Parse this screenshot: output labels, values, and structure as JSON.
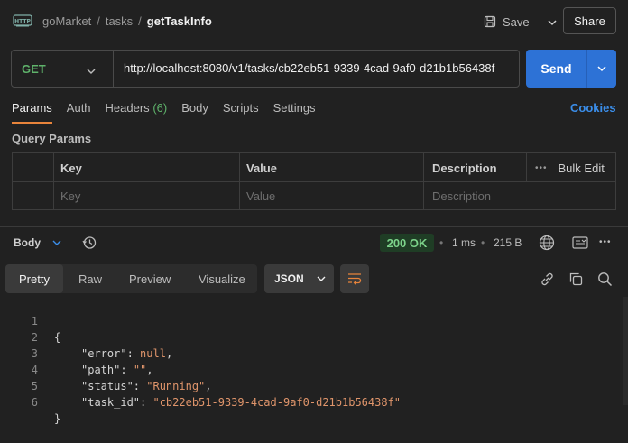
{
  "header": {
    "breadcrumb": [
      "goMarket",
      "tasks",
      "getTaskInfo"
    ],
    "save_label": "Save",
    "share_label": "Share",
    "icon_text": "HTTP"
  },
  "request": {
    "method": "GET",
    "url": "http://localhost:8080/v1/tasks/cb22eb51-9339-4cad-9af0-d21b1b56438f",
    "send_label": "Send"
  },
  "tabs": {
    "params": "Params",
    "auth": "Auth",
    "headers": "Headers",
    "headers_count": "(6)",
    "body": "Body",
    "scripts": "Scripts",
    "settings": "Settings",
    "cookies": "Cookies"
  },
  "query_params": {
    "title": "Query Params",
    "columns": [
      "Key",
      "Value",
      "Description"
    ],
    "bulk_edit": "Bulk Edit",
    "placeholders": [
      "Key",
      "Value",
      "Description"
    ]
  },
  "response": {
    "body_label": "Body",
    "status": "200 OK",
    "time": "1 ms",
    "size": "215 B",
    "view_tabs": [
      "Pretty",
      "Raw",
      "Preview",
      "Visualize"
    ],
    "format": "JSON",
    "line_numbers": [
      "1",
      "2",
      "3",
      "4",
      "5",
      "6"
    ],
    "code": {
      "open": "{",
      "close": "}",
      "k_error": "\"error\"",
      "v_error": "null",
      "k_path": "\"path\"",
      "v_path": "\"\"",
      "k_status": "\"status\"",
      "v_status": "\"Running\"",
      "k_task": "\"task_id\"",
      "v_task": "\"cb22eb51-9339-4cad-9af0-d21b1b56438f\""
    }
  },
  "colors": {
    "background": "#212121",
    "accent": "#e8843b",
    "send": "#2d72d6",
    "method_get": "#5fb36b",
    "link": "#3b8eea"
  }
}
